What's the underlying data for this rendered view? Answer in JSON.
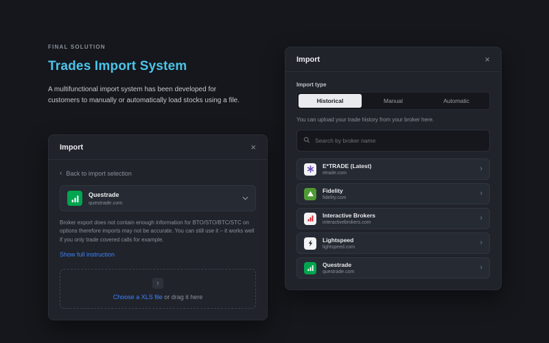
{
  "page": {
    "eyebrow": "FINAL SOLUTION",
    "title": "Trades Import System",
    "description": "A multifunctional import system has been developed for customers to manually or automatically load stocks using a file."
  },
  "icons": {
    "close": "×",
    "back_chevron": "‹",
    "row_chevron": "›",
    "upload_arrow": "↑"
  },
  "left_modal": {
    "title": "Import",
    "back_link": "Back to import selection",
    "broker_select": {
      "name": "Questrade",
      "domain": "questrade.com"
    },
    "warning": "Broker export does not contain enough information for BTO/STO/BTC/STC on options therefore imports may not be accurate. You can still use it – it works well if you only trade covered calls for example.",
    "instruction_link": "Show full instruction",
    "dropzone": {
      "action": "Choose a XLS file",
      "rest": "or drag it here"
    }
  },
  "right_modal": {
    "title": "Import",
    "import_type_label": "Import type",
    "tabs": [
      {
        "label": "Historical"
      },
      {
        "label": "Manual"
      },
      {
        "label": "Automatic"
      }
    ],
    "active_tab": "Historical",
    "caption": "You can upload your trade history from your broker here.",
    "search_placeholder": "Search by broker name",
    "brokers": [
      {
        "name": "E*TRADE (Latest)",
        "domain": "etrade.com"
      },
      {
        "name": "Fidelity",
        "domain": "fidelity.com"
      },
      {
        "name": "Interactive Brokers",
        "domain": "interactivebrokers.com"
      },
      {
        "name": "Lightspeed",
        "domain": "lightspeed.com"
      },
      {
        "name": "Questrade",
        "domain": "questrade.com"
      }
    ]
  },
  "colors": {
    "background": "#15171c",
    "modal_background": "#20232a",
    "accent_blue": "#3f83f8",
    "title_cyan": "#4cc4ea",
    "questrade_green": "#00a550",
    "fidelity_green": "#4e9b33",
    "etrade_purple": "#6b4fbb",
    "interactive_brokers_red": "#dd1625",
    "lightspeed_dark": "#23262b",
    "active_tab_background": "#e9ebee"
  }
}
